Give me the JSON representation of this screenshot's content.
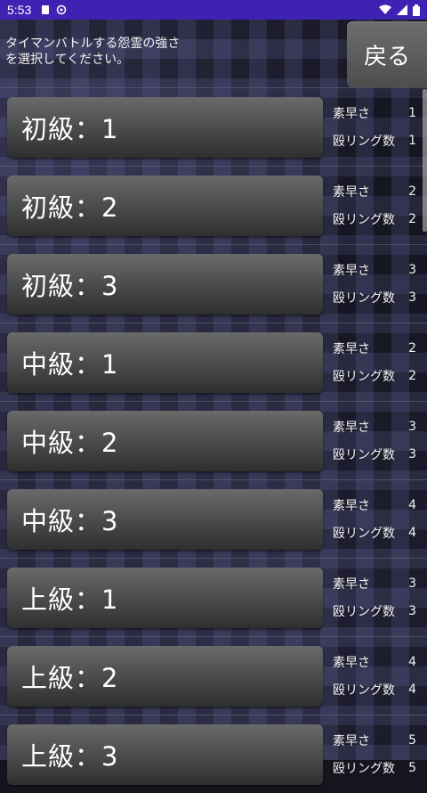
{
  "status": {
    "time": "5:53"
  },
  "header": {
    "instruction": "タイマンバトルする怨霊の強さを選択してください。",
    "back_label": "戻る"
  },
  "levels": [
    {
      "label": "初級：1",
      "speed_label": "素早さ",
      "speed": "1",
      "rings_label": "殴リング数",
      "rings": "1"
    },
    {
      "label": "初級：2",
      "speed_label": "素早さ",
      "speed": "2",
      "rings_label": "殴リング数",
      "rings": "2"
    },
    {
      "label": "初級：3",
      "speed_label": "素早さ",
      "speed": "3",
      "rings_label": "殴リング数",
      "rings": "3"
    },
    {
      "label": "中級：1",
      "speed_label": "素早さ",
      "speed": "2",
      "rings_label": "殴リング数",
      "rings": "2"
    },
    {
      "label": "中級：2",
      "speed_label": "素早さ",
      "speed": "3",
      "rings_label": "殴リング数",
      "rings": "3"
    },
    {
      "label": "中級：3",
      "speed_label": "素早さ",
      "speed": "4",
      "rings_label": "殴リング数",
      "rings": "4"
    },
    {
      "label": "上級：1",
      "speed_label": "素早さ",
      "speed": "3",
      "rings_label": "殴リング数",
      "rings": "3"
    },
    {
      "label": "上級：2",
      "speed_label": "素早さ",
      "speed": "4",
      "rings_label": "殴リング数",
      "rings": "4"
    },
    {
      "label": "上級：3",
      "speed_label": "素早さ",
      "speed": "5",
      "rings_label": "殴リング数",
      "rings": "5"
    }
  ]
}
